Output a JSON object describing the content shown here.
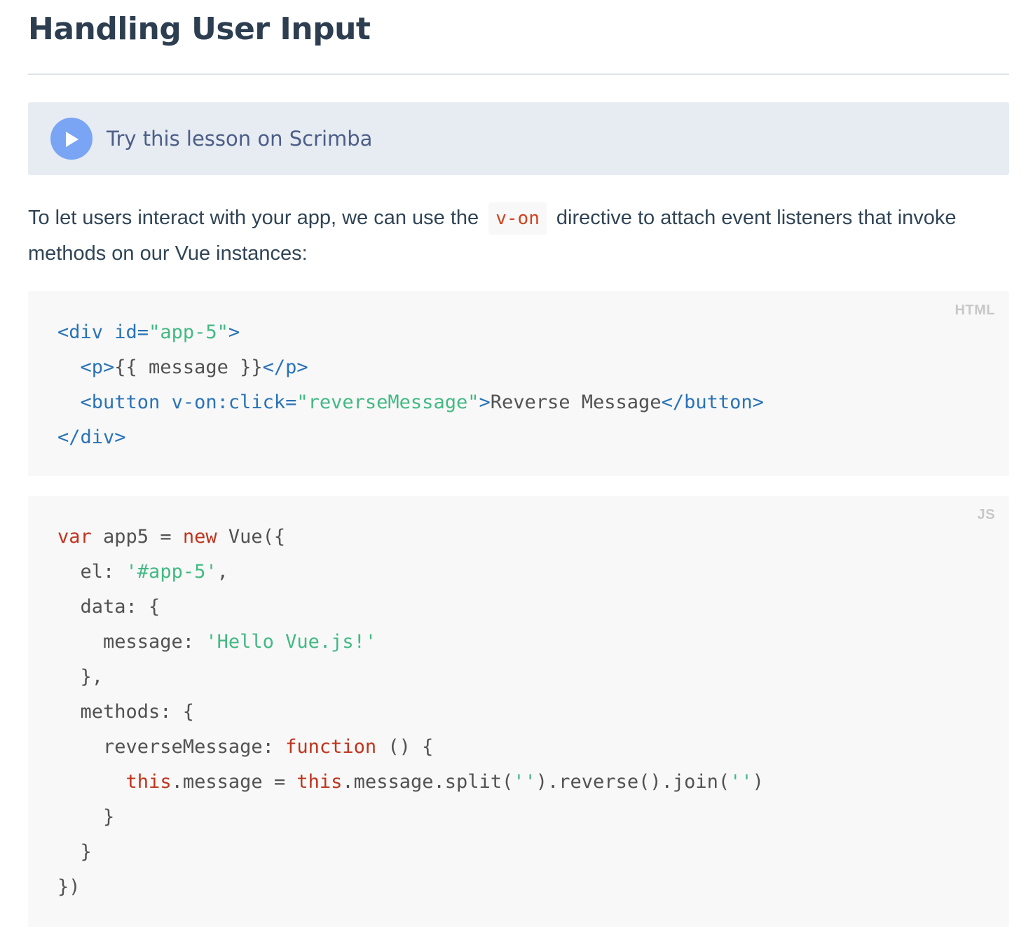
{
  "section": {
    "title": "Handling User Input"
  },
  "scrimba": {
    "label": "Try this lesson on Scrimba",
    "icon": "play-icon"
  },
  "intro": {
    "before": "To let users interact with your app, we can use the",
    "code": "v-on",
    "after": "directive to attach event listeners that invoke methods on our Vue instances:"
  },
  "html_block": {
    "lang": "HTML",
    "lines": [
      [
        {
          "t": "<div ",
          "c": "tag"
        },
        {
          "t": "id=",
          "c": "attr"
        },
        {
          "t": "\"app-5\"",
          "c": "str"
        },
        {
          "t": ">",
          "c": "tag"
        }
      ],
      [
        {
          "t": "  <p>",
          "c": "tag"
        },
        {
          "t": "{{ message }}",
          "c": "plain"
        },
        {
          "t": "</p>",
          "c": "tag"
        }
      ],
      [
        {
          "t": "  <button ",
          "c": "tag"
        },
        {
          "t": "v-on:click=",
          "c": "attr"
        },
        {
          "t": "\"reverseMessage\"",
          "c": "str"
        },
        {
          "t": ">",
          "c": "tag"
        },
        {
          "t": "Reverse Message",
          "c": "plain"
        },
        {
          "t": "</button>",
          "c": "tag"
        }
      ],
      [
        {
          "t": "</div>",
          "c": "tag"
        }
      ]
    ]
  },
  "js_block": {
    "lang": "JS",
    "lines": [
      [
        {
          "t": "var",
          "c": "kw"
        },
        {
          "t": " app5 = ",
          "c": "plain"
        },
        {
          "t": "new",
          "c": "kw"
        },
        {
          "t": " Vue({",
          "c": "plain"
        }
      ],
      [
        {
          "t": "  el: ",
          "c": "plain"
        },
        {
          "t": "'#app-5'",
          "c": "str"
        },
        {
          "t": ",",
          "c": "plain"
        }
      ],
      [
        {
          "t": "  data: {",
          "c": "plain"
        }
      ],
      [
        {
          "t": "    message: ",
          "c": "plain"
        },
        {
          "t": "'Hello Vue.js!'",
          "c": "str"
        }
      ],
      [
        {
          "t": "  },",
          "c": "plain"
        }
      ],
      [
        {
          "t": "  methods: {",
          "c": "plain"
        }
      ],
      [
        {
          "t": "    reverseMessage: ",
          "c": "plain"
        },
        {
          "t": "function",
          "c": "kw"
        },
        {
          "t": " () {",
          "c": "plain"
        }
      ],
      [
        {
          "t": "      ",
          "c": "plain"
        },
        {
          "t": "this",
          "c": "kw"
        },
        {
          "t": ".message = ",
          "c": "plain"
        },
        {
          "t": "this",
          "c": "kw"
        },
        {
          "t": ".message.split(",
          "c": "plain"
        },
        {
          "t": "''",
          "c": "str"
        },
        {
          "t": ").reverse().join(",
          "c": "plain"
        },
        {
          "t": "''",
          "c": "str"
        },
        {
          "t": ")",
          "c": "plain"
        }
      ],
      [
        {
          "t": "    }",
          "c": "plain"
        }
      ],
      [
        {
          "t": "  }",
          "c": "plain"
        }
      ],
      [
        {
          "t": "})",
          "c": "plain"
        }
      ]
    ]
  },
  "colors": {
    "tag": "#2973b7",
    "string": "#42b983",
    "keyword": "#c0341d",
    "scrimba_bg": "#e7ecf3",
    "play_button": "#7aa5f5"
  }
}
